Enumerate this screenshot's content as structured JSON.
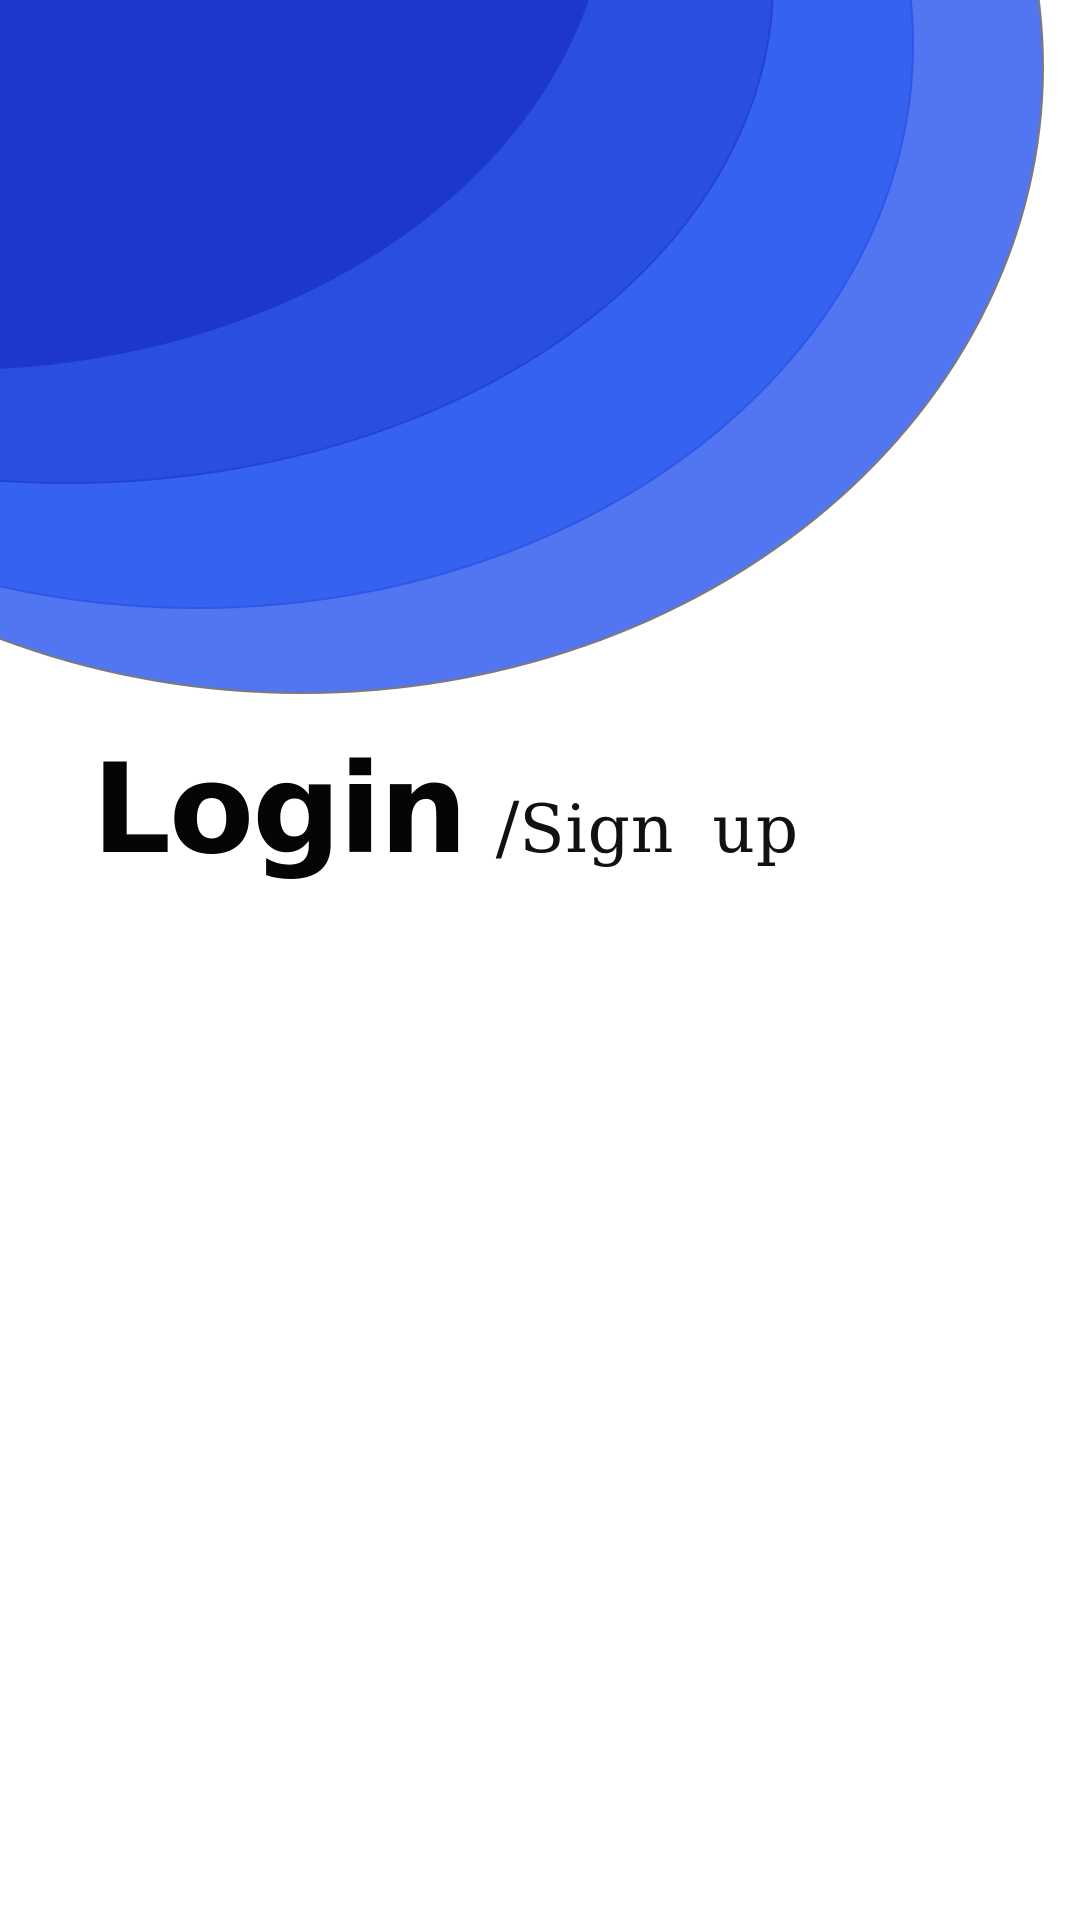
{
  "header": {
    "login_label": "Login",
    "separator": "/",
    "signup_label": "Sign  up"
  },
  "colors": {
    "layer1": "#5275f2",
    "layer2": "#3662f0",
    "layer3": "#2a4fe0",
    "layer4": "#1c37c9",
    "background": "#ffffff",
    "text": "#050505"
  }
}
